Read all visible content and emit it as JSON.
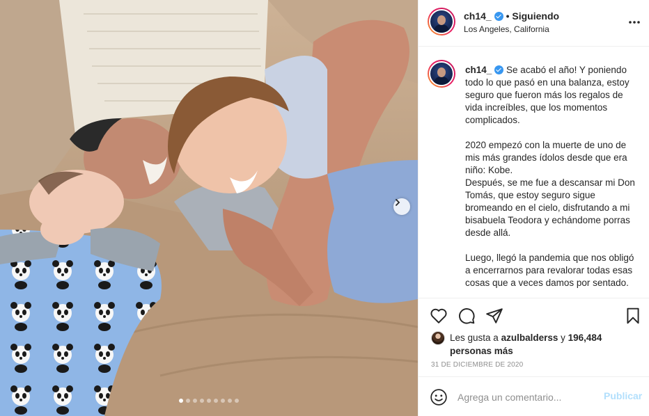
{
  "colors": {
    "brand_blue": "#0095f6",
    "verified_blue": "#3897f0",
    "text_primary": "#262626",
    "text_secondary": "#8e8e8e",
    "publish_disabled": "#b2dffc"
  },
  "media": {
    "carousel": {
      "total": 9,
      "current": 1
    },
    "next_icon": "chevron-right-icon"
  },
  "header": {
    "username": "ch14_",
    "separator": " • ",
    "following_label": "Siguiendo",
    "location": "Los Angeles, California",
    "more_icon": "more-horizontal-icon"
  },
  "caption": {
    "username": "ch14_",
    "text": "Se acabó el año! Y poniendo todo lo que pasó en una balanza, estoy seguro que fueron más los regalos de vida increíbles, que los momentos complicados.\n\n2020 empezó con la muerte de uno de mis más grandes ídolos desde que era niño: Kobe.\nDespués, se me fue a descansar mi Don Tomás, que estoy seguro sigue bromeando en el cielo, disfrutando a mi bisabuela Teodora y echándome porras desde allá.\n\nLuego, llegó la pandemia que nos obligó a encerrarnos para revalorar todas esas cosas que a veces damos por sentado."
  },
  "actions": {
    "like_icon": "heart-icon",
    "comment_icon": "comment-icon",
    "share_icon": "send-icon",
    "save_icon": "bookmark-icon"
  },
  "likes": {
    "prefix": "Les gusta a ",
    "first_user": "azulbalderss",
    "middle": " y ",
    "others": "196,484 personas más"
  },
  "post_date": "31 DE DICIEMBRE DE 2020",
  "comment_box": {
    "placeholder": "Agrega un comentario...",
    "publish_label": "Publicar",
    "emoji_icon": "smiley-icon"
  }
}
